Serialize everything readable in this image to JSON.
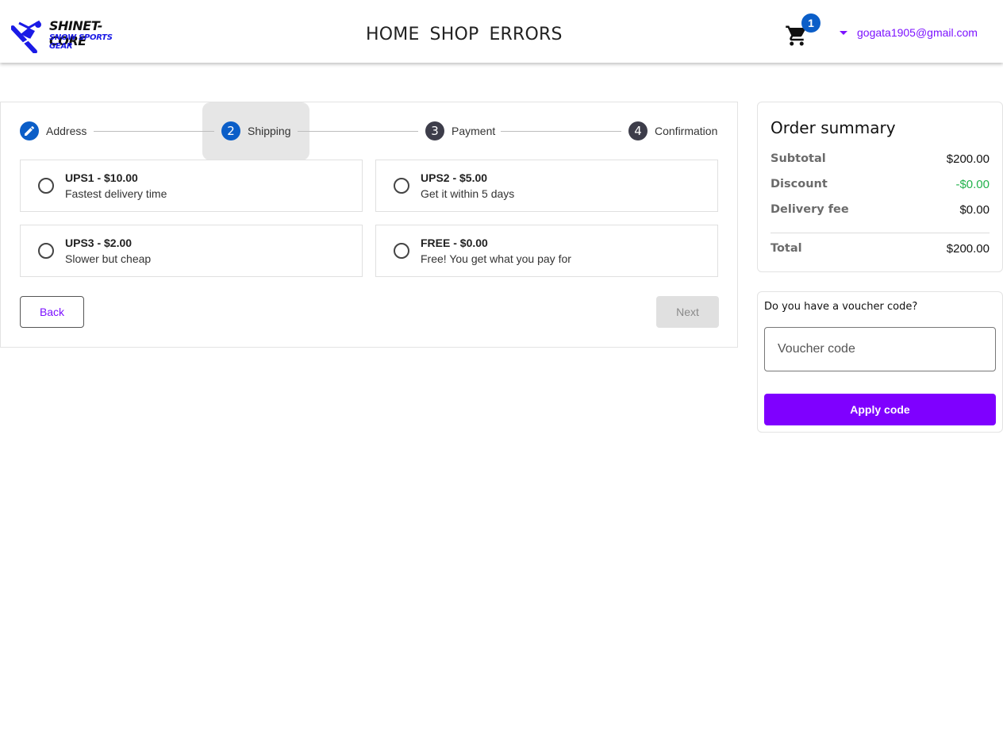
{
  "header": {
    "logo": {
      "line1": "SHINET-CORE",
      "line2": "SNOW SPORTS GEAR"
    },
    "nav": [
      "HOME",
      "SHOP",
      "ERRORS"
    ],
    "cart_count": "1",
    "user_email": "gogata1905@gmail.com"
  },
  "stepper": {
    "steps": [
      {
        "label": "Address",
        "number": "",
        "state": "done"
      },
      {
        "label": "Shipping",
        "number": "2",
        "state": "active"
      },
      {
        "label": "Payment",
        "number": "3",
        "state": "todo"
      },
      {
        "label": "Confirmation",
        "number": "4",
        "state": "todo"
      }
    ],
    "options": [
      {
        "title": "UPS1 - $10.00",
        "desc": "Fastest delivery time",
        "selected": false
      },
      {
        "title": "UPS2 - $5.00",
        "desc": "Get it within 5 days",
        "selected": false
      },
      {
        "title": "UPS3 - $2.00",
        "desc": "Slower but cheap",
        "selected": false
      },
      {
        "title": "FREE - $0.00",
        "desc": "Free! You get what you pay for",
        "selected": false
      }
    ],
    "back_label": "Back",
    "next_label": "Next"
  },
  "summary": {
    "title": "Order summary",
    "subtotal_label": "Subtotal",
    "subtotal": "$200.00",
    "discount_label": "Discount",
    "discount": "-$0.00",
    "delivery_label": "Delivery fee",
    "delivery": "$0.00",
    "total_label": "Total",
    "total": "$200.00"
  },
  "voucher": {
    "question": "Do you have a voucher code?",
    "placeholder": "Voucher code",
    "apply_label": "Apply code"
  },
  "colors": {
    "accent": "#7f00ff",
    "step_active": "#0b5ec8",
    "discount_green": "#22b24c"
  }
}
